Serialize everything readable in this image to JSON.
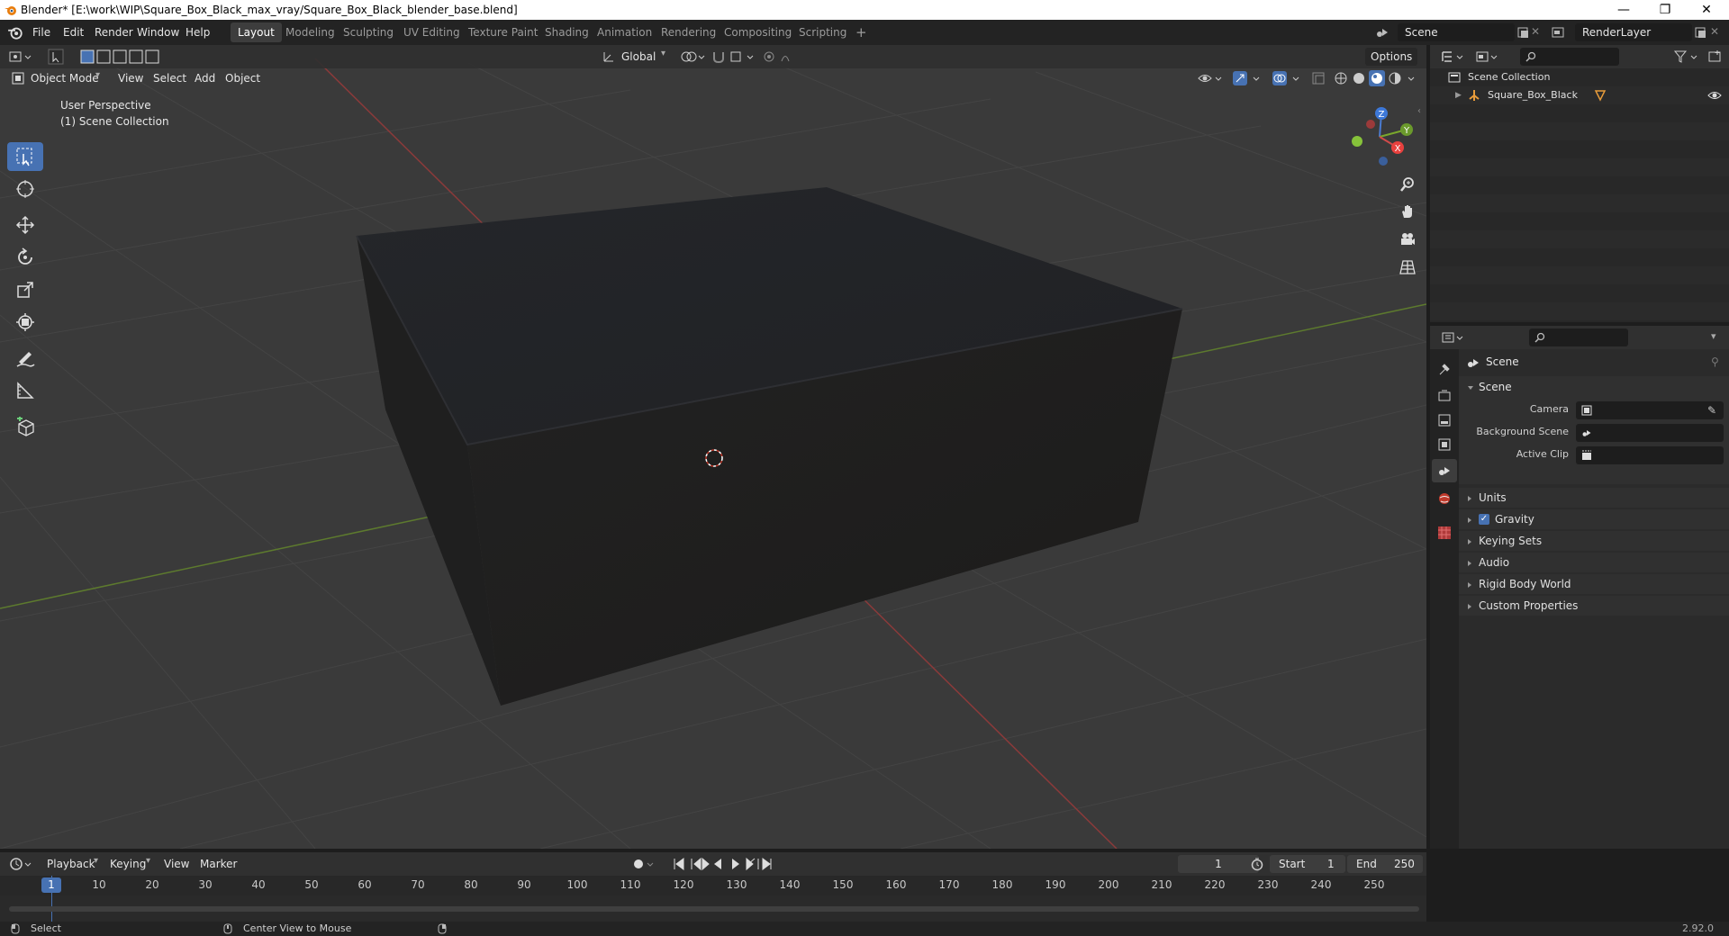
{
  "window": {
    "title": "Blender* [E:\\work\\WIP\\Square_Box_Black_max_vray/Square_Box_Black_blender_base.blend]",
    "minimize": "—",
    "maximize": "❐",
    "close": "✕"
  },
  "menu": [
    "File",
    "Edit",
    "Render",
    "Window",
    "Help"
  ],
  "workspaces": {
    "tabs": [
      "Layout",
      "Modeling",
      "Sculpting",
      "UV Editing",
      "Texture Paint",
      "Shading",
      "Animation",
      "Rendering",
      "Compositing",
      "Scripting"
    ],
    "active": "Layout",
    "add": "+"
  },
  "scene_field": "Scene",
  "view_layer_field": "RenderLayer",
  "viewport": {
    "header": {
      "mode": "Object Mode",
      "menus": [
        "View",
        "Select",
        "Add",
        "Object"
      ],
      "transform_orientation": "Global",
      "options": "Options"
    },
    "overlay_text": {
      "line1": "User Perspective",
      "line2": "(1) Scene Collection"
    },
    "gizmo": {
      "x": "X",
      "y": "Y",
      "z": "Z"
    },
    "colors": {
      "background": "#3a3a3a",
      "grid": "#434343",
      "x_axis": "#8b3a3a",
      "y_axis": "#5d7a2e",
      "box_top": "#25272b",
      "box_front": "#1e1e1e",
      "box_left": "#222222"
    }
  },
  "tools": [
    "select-box-icon",
    "cursor-icon",
    "move-icon",
    "rotate-icon",
    "scale-icon",
    "transform-icon",
    "annotate-icon",
    "measure-icon",
    "add-cube-icon"
  ],
  "outliner": {
    "root": "Scene Collection",
    "items": [
      {
        "name": "Square_Box_Black"
      }
    ]
  },
  "properties": {
    "context_title": "Scene",
    "panel": "Scene",
    "fields": [
      {
        "label": "Camera",
        "value": ""
      },
      {
        "label": "Background Scene",
        "value": ""
      },
      {
        "label": "Active Clip",
        "value": ""
      }
    ],
    "subpanels": [
      "Units",
      "Gravity",
      "Keying Sets",
      "Audio",
      "Rigid Body World",
      "Custom Properties"
    ],
    "gravity_checked": true
  },
  "timeline": {
    "menus": [
      "Playback",
      "Keying",
      "View",
      "Marker"
    ],
    "current_frame": "1",
    "start_label": "Start",
    "start": "1",
    "end_label": "End",
    "end": "250",
    "ticks": [
      "1",
      "10",
      "20",
      "30",
      "40",
      "50",
      "60",
      "70",
      "80",
      "90",
      "100",
      "110",
      "120",
      "130",
      "140",
      "150",
      "160",
      "170",
      "180",
      "190",
      "200",
      "210",
      "220",
      "230",
      "240",
      "250"
    ]
  },
  "status": {
    "select": "Select",
    "center": "Center View to Mouse",
    "version": "2.92.0"
  }
}
